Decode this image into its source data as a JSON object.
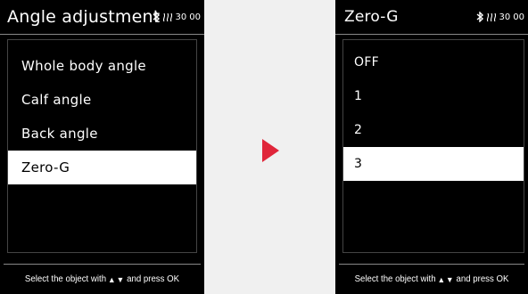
{
  "left_screen": {
    "title": "Angle adjustment",
    "status": {
      "level": "30",
      "extra": "00"
    },
    "items": [
      "Whole body angle",
      "Calf angle",
      "Back angle",
      "Zero-G"
    ],
    "selected_index": 3,
    "footer": {
      "before": "Select the object with",
      "arrows": "▲▼",
      "after": "and press OK"
    }
  },
  "right_screen": {
    "title": "Zero-G",
    "status": {
      "level": "30",
      "extra": "00"
    },
    "items": [
      "OFF",
      "1",
      "2",
      "3"
    ],
    "selected_index": 3,
    "footer": {
      "before": "Select the object with",
      "arrows": "▲▼",
      "after": "and press OK"
    }
  },
  "colors": {
    "arrow": "#e0263a",
    "screen_bg": "#000000",
    "selection": "#ffffff"
  },
  "icons": [
    "bluetooth-icon",
    "heat-icon",
    "next-arrow-icon"
  ]
}
